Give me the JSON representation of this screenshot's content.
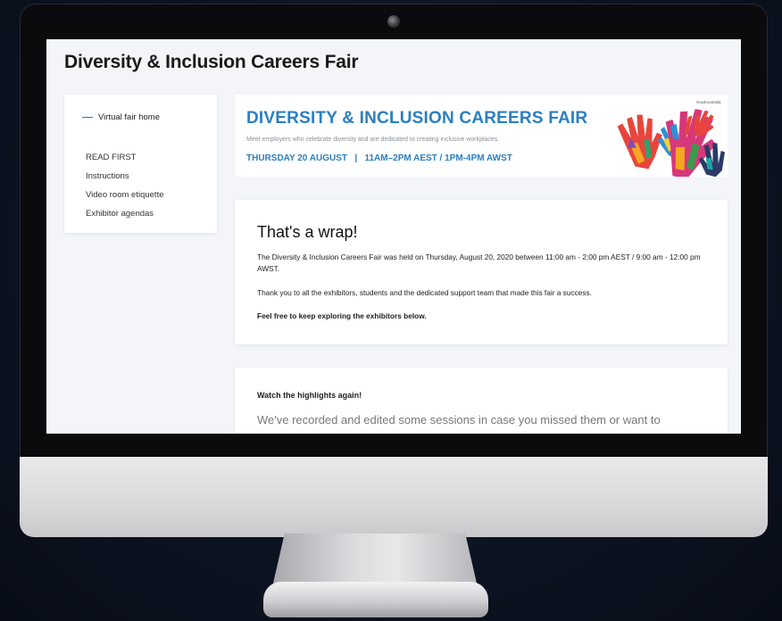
{
  "page": {
    "title": "Diversity & Inclusion Careers Fair"
  },
  "sidebar": {
    "home_label": "Virtual fair home",
    "items": [
      {
        "label": "READ FIRST"
      },
      {
        "label": "Instructions"
      },
      {
        "label": "Video room etiquette"
      },
      {
        "label": "Exhibitor agendas"
      }
    ]
  },
  "banner": {
    "title": "DIVERSITY & INCLUSION CAREERS FAIR",
    "subtitle": "Meet employers who celebrate diversity and are dedicated to creating inclusive workplaces.",
    "date_line": "THURSDAY 20 AUGUST   |   11AM–2PM AEST / 1PM-4PM AWST",
    "brand": "GradAustralia",
    "icon": "colorful-hands-icon"
  },
  "wrap_card": {
    "title": "That's a wrap!",
    "paragraph1": "The Diversity & Inclusion Careers Fair was held on Thursday, August 20, 2020 between 11:00 am - 2:00 pm AEST / 9:00 am - 12:00 pm AWST.",
    "paragraph2": "Thank you to all the exhibitors, students and the dedicated support team that made this fair a success.",
    "paragraph3": "Feel free to keep exploring the exhibitors below."
  },
  "highlights_card": {
    "title": "Watch the highlights again!",
    "text": "We've recorded and edited some sessions in case you missed them or want to"
  },
  "colors": {
    "accent": "#2a7fc3",
    "nav_marker": "#2e6fd0",
    "screen_bg": "#f3f5f9"
  }
}
